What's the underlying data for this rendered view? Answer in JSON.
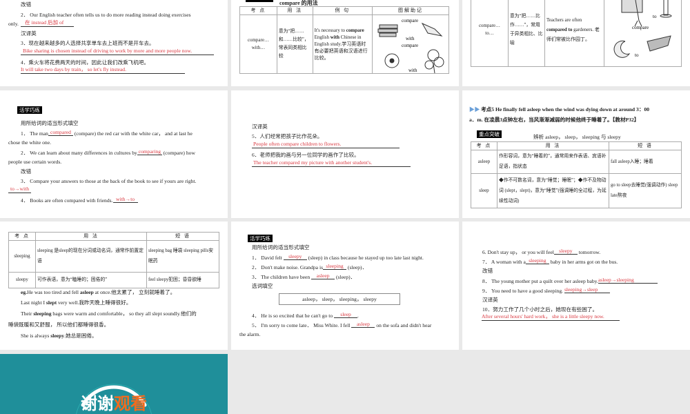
{
  "slide1": {
    "h1": "改错",
    "q2": "2． Our English teacher often tells us to do more reading instead doing exercises",
    "q2b": "only.",
    "a2": "在 instead 后加 of",
    "h2": "汉译英",
    "q3": "3．现在越来越多的人选择共享单车去上班而不是开车去。",
    "a3": "Bike sharing is chosen instead of driving to work by more and more people now.",
    "q4": "4．乘火车将花费两天的时间，因此让我们改乘飞机吧。",
    "a4": "It will take two days by train， so let's fly instead."
  },
  "slide2": {
    "title": "compare 的用法",
    "headers": [
      "考 点",
      "用 法",
      "例 句",
      "图解助记"
    ],
    "point": "compare…with…",
    "usage": "意为“把……和……比较”，常表同类相比较",
    "example_pre": "It's necessary to ",
    "ex_b1": "compare",
    "ex_mid": " English ",
    "ex_b2": "with",
    "ex_post": " Chinese in English study.学习英语时有必要把英语和汉语进行比较。",
    "img_words": [
      "compare",
      "with",
      "compare",
      "with"
    ]
  },
  "slide3": {
    "point": "compare…to…",
    "usage": "意为“把……比作……”，常用于异类相比、比喻",
    "ex_pre": "Teachers are often ",
    "ex_b": "compared to",
    "ex_post": " gardeners.",
    "ex_cn": "老师们常被比作园丁。",
    "img_words": [
      "to",
      "compare",
      "to"
    ]
  },
  "slide4": {
    "label": "活学巧练",
    "instr": "用所给词的适当形式填空",
    "q1_pre": "1． The man",
    "a1": "compared",
    "q1_post": " (compare) the red car with the white car， and at last he",
    "q1b": "chose the white one.",
    "q2_pre": "2． We can learn about many differences in cultures by",
    "a2": "comparing",
    "q2_post": " (compare) how",
    "q2b": "people use certain words.",
    "h2": "改错",
    "q3": "3． Compare your answers to those at the back of the book to see if yours are right.",
    "a3": "to→with",
    "q4": "4． Books are often compared with friends.",
    "a4": "with→to"
  },
  "slide5": {
    "h": "汉译英",
    "q5": "5．人们经常把孩子比作花朵。",
    "a5": "People often compare children to flowers.",
    "q6": "6．老师把我的画与另一位同学的画作了比较。",
    "a6": "The teacher compared my picture with another student's."
  },
  "slide6": {
    "line1": "考点5 He finally fell asleep when the wind was dying down at around 3：00",
    "line2": "a．m. 在凌晨3点钟左右，当风渐渐减弱的时候他终于睡着了。【教材P32】",
    "label": "重点突破",
    "caption": "辨析 asleep， sleep， sleeping 与 sleepy",
    "headers": [
      "考 点",
      "用 法",
      "短 语"
    ],
    "rows": [
      {
        "point": "asleep",
        "usage": "作形容词，意为“睡着的”，通常用来作表语、宾语补足语，指状态",
        "phrase": "fall asleep入睡；睡着"
      },
      {
        "point": "sleep",
        "usage": "◆作不可数名词，意为“睡觉；睡眠”；◆作不及物动词 (slept，slept)，意为“睡觉”(强调睡的全过程，为延续性动词)",
        "phrase": "go to sleep去睡觉(强调动作) sleep late熬夜"
      }
    ]
  },
  "slide7": {
    "headers": [
      "考 点",
      "用 法",
      "短 语"
    ],
    "rows": [
      {
        "point": "sleeping",
        "usage": "sleeping 是sleep的现在分词或动名词，通常作前置定语",
        "phrase": "sleeping bag 睡袋 sleeping pills安眠药"
      },
      {
        "point": "sleepy",
        "usage": "可作表语，意为“瞌睡的；困倦的”",
        "phrase": "feel sleepy犯困；昏昏欲睡"
      }
    ],
    "eg1_pre": "eg.",
    "eg1": "He was too tired and fell ",
    "eg1_b": "asleep",
    "eg1_post": " at once.他太累了， 立刻就睡着了。",
    "eg2_pre": "Last night I ",
    "eg2_b": "slept",
    "eg2_post": " very well.我昨天晚上睡得很好。",
    "eg3_pre": "Their ",
    "eg3_b": "sleeping",
    "eg3_post": " bags were warm and comfortable， so they all slept soundly.他们的",
    "eg3b": "睡袋既暖和又舒服， 所以他们都睡得很香。",
    "eg4_pre": "She is always ",
    "eg4_b": "sleepy",
    "eg4_post": ".她总是困倦。"
  },
  "slide8": {
    "label": "活学巧练",
    "instr": "用所给词的适当形式填空",
    "q1_pre": "1． David felt ",
    "a1": "sleepy",
    "q1_post": " (sleep) in class because he stayed up too late last night.",
    "q2_pre": "2． Don't make noise. Grandpa is",
    "a2": "sleeping",
    "q2_post": " (sleep)．",
    "q3_pre": "3． The children have been ",
    "a3": "asleep",
    "q3_post": " (sleep)．",
    "h2": "选词填空",
    "box": "asleep， sleep， sleeping， sleepy",
    "q4_pre": "4． He is so excited that he can't go to ",
    "a4": "sleep",
    "q4_post": ".",
    "q5_pre": "5． I'm sorry to come late． Miss White. I fell ",
    "a5": "asleep",
    "q5_post": " on the sofa and didn't hear",
    "q5b": "the alarm."
  },
  "slide9": {
    "q6_pre": "6. Don't stay up， or you will feel",
    "a6": "sleepy",
    "q6_post": " tomorrow.",
    "q7_pre": "7． A woman with a",
    "a7": "sleeping",
    "q7_post": " baby in her arms got on the bus.",
    "h1": "改错",
    "q8": "8． The young mother put a quilt over her asleep baby.",
    "a8": "asleep→sleeping",
    "q9": "9． You need to have a good sleeping.",
    "a9": "sleeping→sleep",
    "h2": "汉译英",
    "q10": "10．努力工作了几个小时之后，她现在有些困了。",
    "a10": "After several hours' hard work， she is a little sleepy now."
  },
  "slide10": {
    "title_white": "谢谢",
    "title_orange": "观看",
    "colors": {
      "teal": "#1f8f9a",
      "orange": "#f26b1d"
    }
  }
}
